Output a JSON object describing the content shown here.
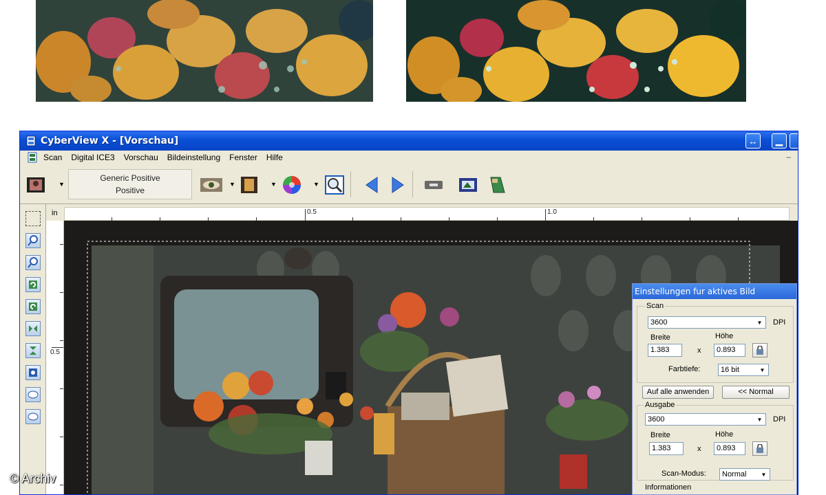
{
  "window": {
    "title": "CyberView X - [Vorschau]",
    "restore_icon": "double-arrow-icon",
    "minimize_icon": "minimize-icon"
  },
  "menu": {
    "items": [
      "Scan",
      "Digital ICE3",
      "Vorschau",
      "Bildeinstellung",
      "Fenster",
      "Hilfe"
    ],
    "mdi_minimize": "–"
  },
  "toolbar": {
    "film_type": "Generic Positive",
    "film_subtype": "Positive",
    "icons": [
      "film-frame-icon",
      "eye-icon",
      "filmstrip-icon",
      "color-wheel-icon",
      "zoom-preview-icon",
      "previous-arrow-icon",
      "next-arrow-icon",
      "eject-icon",
      "scan-frame-icon",
      "scanner-icon"
    ]
  },
  "side_tools": {
    "icons": [
      "crop-select-icon",
      "zoom-in-icon",
      "zoom-out-icon",
      "rotate-left-icon",
      "rotate-right-icon",
      "flip-horizontal-icon",
      "flip-vertical-icon",
      "reset-icon",
      "ice-icon",
      "gem-icon"
    ]
  },
  "ruler": {
    "unit": "in",
    "top_labels": [
      "0.5",
      "1.0"
    ],
    "left_labels": [
      "0.5"
    ]
  },
  "settings_panel": {
    "title": "Einstellungen fur aktives Bild",
    "scan": {
      "group_label": "Scan",
      "dpi_value": "3600",
      "dpi_unit": "DPI",
      "width_label": "Breite",
      "height_label": "Höhe",
      "width_value": "1.383",
      "height_value": "0.893",
      "times": "x",
      "depth_label": "Farbtiefe:",
      "depth_value": "16 bit"
    },
    "apply_all_label": "Auf alle anwenden",
    "normal_label": "<< Normal",
    "output": {
      "group_label": "Ausgabe",
      "dpi_value": "3600",
      "dpi_unit": "DPI",
      "width_label": "Breite",
      "height_label": "Höhe",
      "width_value": "1.383",
      "height_value": "0.893",
      "times": "x",
      "mode_label": "Scan-Modus:",
      "mode_value": "Normal"
    },
    "info_label": "Informationen"
  },
  "watermark": "© Archiv"
}
